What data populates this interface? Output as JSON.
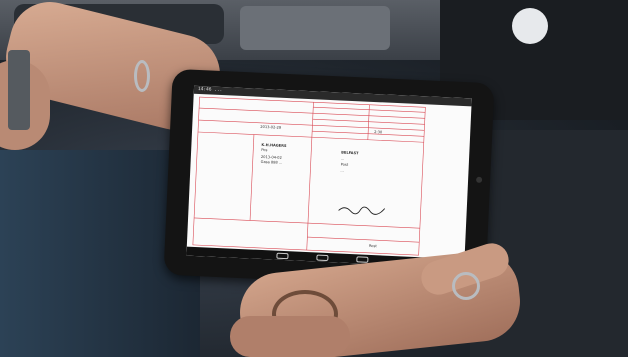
{
  "scene": {
    "colors": {
      "cab_dark": "#1f252c",
      "skin": "#c79a82",
      "document_lines": "#d94a55",
      "screen": "#fbfbfb",
      "bezel": "#141414"
    }
  },
  "tablet": {
    "status_text": "14:46 ...",
    "document": {
      "sender_block": [
        "K.H.HAGERS",
        "Pos",
        "2013-04-02",
        "Gasa 888 ..."
      ],
      "receiver_block": [
        "BELFAST",
        "...",
        "Post",
        "..."
      ],
      "date_field": "2013-02-28",
      "field_value": "2:30",
      "footer_text": "Rost"
    }
  }
}
